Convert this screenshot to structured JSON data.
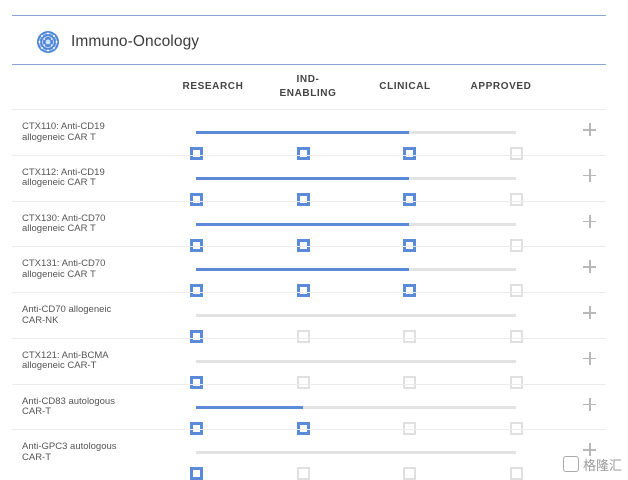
{
  "section": {
    "title": "Immuno-Oncology",
    "icon": "cell-sphere-icon"
  },
  "stages": [
    {
      "id": "research",
      "lines": [
        "RESEARCH"
      ]
    },
    {
      "id": "ind",
      "lines": [
        "IND-",
        "ENABLING"
      ]
    },
    {
      "id": "clinical",
      "lines": [
        "CLINICAL"
      ]
    },
    {
      "id": "approved",
      "lines": [
        "APPROVED"
      ]
    }
  ],
  "programs": [
    {
      "line1": "CTX110: Anti-CD19",
      "line2": "allogeneic CAR T",
      "stage_reached": 3
    },
    {
      "line1": "CTX112: Anti-CD19",
      "line2": "allogeneic CAR T",
      "stage_reached": 3
    },
    {
      "line1": "CTX130: Anti-CD70",
      "line2": "allogeneic CAR T",
      "stage_reached": 3
    },
    {
      "line1": "CTX131: Anti-CD70",
      "line2": "allogeneic CAR T",
      "stage_reached": 3
    },
    {
      "line1": "Anti-CD70 allogeneic",
      "line2": "CAR-NK",
      "stage_reached": 1
    },
    {
      "line1": "CTX121: Anti-BCMA",
      "line2": "allogeneic CAR-T",
      "stage_reached": 1
    },
    {
      "line1": "Anti-CD83 autologous",
      "line2": "CAR-T",
      "stage_reached": 2
    },
    {
      "line1": "Anti-GPC3 autologous",
      "line2": "CAR-T",
      "stage_reached": 1
    }
  ],
  "colors": {
    "active": "#5b8bd8",
    "inactive": "#e0e0e0",
    "rule": "#8aa6d4"
  },
  "watermark": {
    "text": "格隆汇",
    "icon": "watermark-logo-icon"
  }
}
